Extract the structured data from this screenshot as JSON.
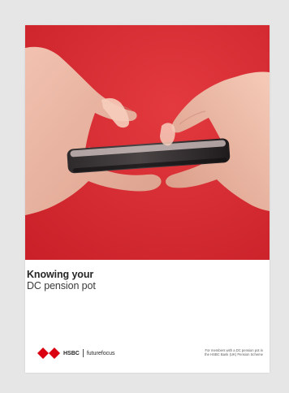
{
  "document": {
    "title_line_1": "Knowing your",
    "title_line_2": "DC pension pot",
    "brand_name": "HSBC",
    "brand_subtitle": "futurefocus",
    "members_note_line_1": "For members with a DC pension pot in",
    "members_note_line_2": "the HSBC Bank (UK) Pension Scheme"
  },
  "colors": {
    "page_background": "#e6e6e6",
    "cover_red": "#d8262f",
    "logo_red": "#db0011",
    "text_dark": "#262626"
  },
  "icons": {
    "logo_mark": "hsbc-hexagon-logo-icon"
  }
}
